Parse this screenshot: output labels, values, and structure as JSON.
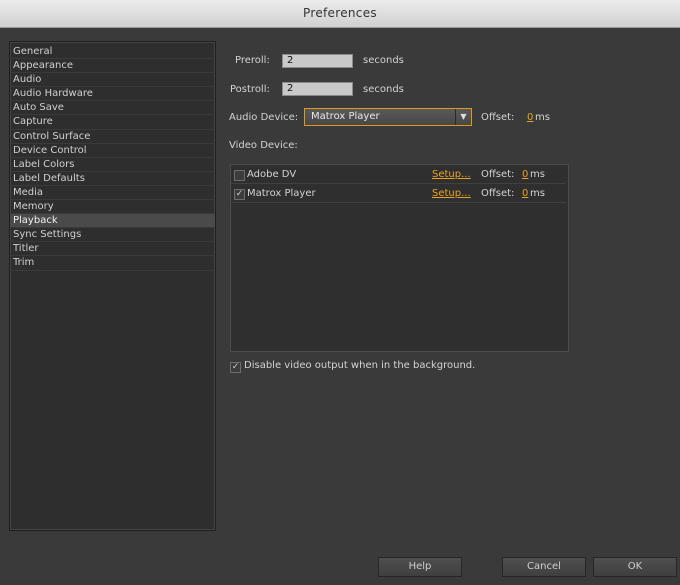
{
  "window": {
    "title": "Preferences"
  },
  "sidebar": {
    "items": [
      {
        "label": "General"
      },
      {
        "label": "Appearance"
      },
      {
        "label": "Audio"
      },
      {
        "label": "Audio Hardware"
      },
      {
        "label": "Auto Save"
      },
      {
        "label": "Capture"
      },
      {
        "label": "Control Surface"
      },
      {
        "label": "Device Control"
      },
      {
        "label": "Label Colors"
      },
      {
        "label": "Label Defaults"
      },
      {
        "label": "Media"
      },
      {
        "label": "Memory"
      },
      {
        "label": "Playback",
        "selected": true
      },
      {
        "label": "Sync Settings"
      },
      {
        "label": "Titler"
      },
      {
        "label": "Trim"
      }
    ]
  },
  "playback": {
    "preroll": {
      "label": "Preroll:",
      "value": "2",
      "unit": "seconds"
    },
    "postroll": {
      "label": "Postroll:",
      "value": "2",
      "unit": "seconds"
    },
    "audio_device": {
      "label": "Audio Device:",
      "selected": "Matrox Player",
      "offset_label": "Offset:",
      "offset_value": "0",
      "offset_unit": "ms"
    },
    "video_device": {
      "label": "Video Device:",
      "devices": [
        {
          "name": "Adobe DV",
          "checked": false,
          "setup_label": "Setup...",
          "offset_label": "Offset:",
          "offset_value": "0",
          "offset_unit": "ms"
        },
        {
          "name": "Matrox Player",
          "checked": true,
          "setup_label": "Setup...",
          "offset_label": "Offset:",
          "offset_value": "0",
          "offset_unit": "ms"
        }
      ]
    },
    "disable_background": {
      "checked": true,
      "label": "Disable video output when in the background."
    }
  },
  "footer": {
    "help_label": "Help",
    "cancel_label": "Cancel",
    "ok_label": "OK"
  },
  "colors": {
    "accent": "#e8a323",
    "background": "#3a3a3a"
  }
}
